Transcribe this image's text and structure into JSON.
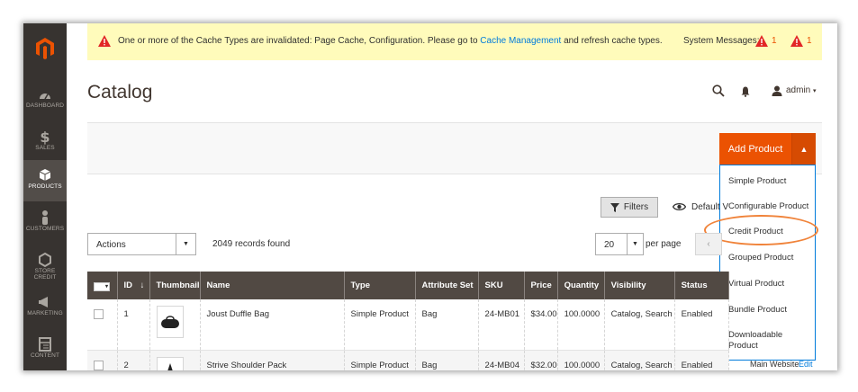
{
  "nav": {
    "items": [
      {
        "label": "DASHBOARD",
        "icon": "dashboard-icon"
      },
      {
        "label": "SALES",
        "icon": "dollar-icon"
      },
      {
        "label": "PRODUCTS",
        "icon": "cube-icon",
        "active": true
      },
      {
        "label": "CUSTOMERS",
        "icon": "person-icon"
      },
      {
        "label": "STORE CREDIT",
        "icon": "hexagon-icon"
      },
      {
        "label": "MARKETING",
        "icon": "megaphone-icon"
      },
      {
        "label": "CONTENT",
        "icon": "layout-icon"
      }
    ]
  },
  "notice": {
    "message_pre": "One or more of the Cache Types are invalidated: Page Cache, Configuration. Please go to ",
    "link": "Cache Management",
    "message_post": " and refresh cache types.",
    "system_label": "System Messages:",
    "count_a": "1",
    "count_b": "1"
  },
  "header": {
    "title": "Catalog",
    "user": "admin"
  },
  "add_product": {
    "label": "Add Product",
    "options": [
      "Simple Product",
      "Configurable Product",
      "Credit Product",
      "Grouped Product",
      "Virtual Product",
      "Bundle Product",
      "Downloadable Product"
    ],
    "highlighted": "Credit Product"
  },
  "toolbar": {
    "filters": "Filters",
    "default_view": "Default V",
    "actions": "Actions",
    "records": "2049 records found",
    "per_page_value": "20",
    "per_page_label": "per page"
  },
  "grid": {
    "headers": [
      "ID",
      "Thumbnail",
      "Name",
      "Type",
      "Attribute Set",
      "SKU",
      "Price",
      "Quantity",
      "Visibility",
      "Status"
    ],
    "rows": [
      {
        "id": "1",
        "name": "Joust Duffle Bag",
        "type": "Simple Product",
        "attr": "Bag",
        "sku": "24-MB01",
        "price": "$34.00",
        "qty": "100.0000",
        "vis": "Catalog, Search",
        "status": "Enabled"
      },
      {
        "id": "2",
        "name": "Strive Shoulder Pack",
        "type": "Simple Product",
        "attr": "Bag",
        "sku": "24-MB04",
        "price": "$32.00",
        "qty": "100.0000",
        "vis": "Catalog, Search",
        "status": "Enabled"
      }
    ],
    "row2_website": "Main Website",
    "row2_action": "Edit"
  },
  "colors": {
    "accent": "#eb5202",
    "nav_bg": "#373330",
    "header_bg": "#514943",
    "link": "#007bdb"
  }
}
